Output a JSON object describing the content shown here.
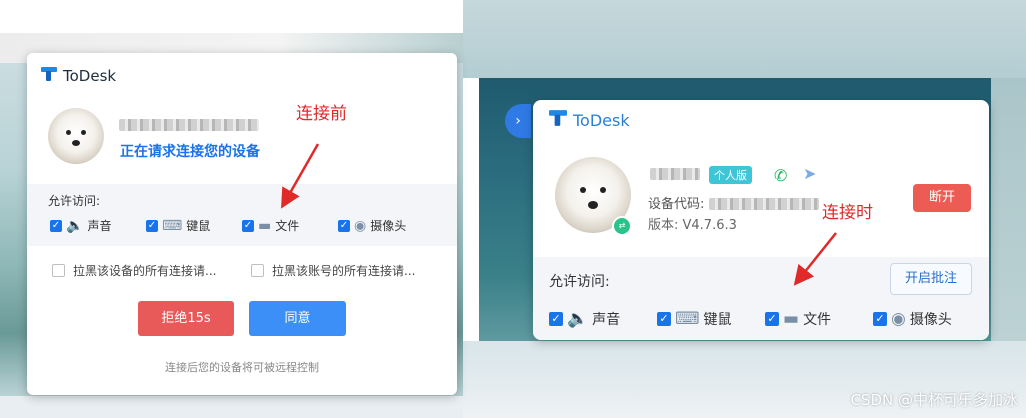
{
  "left_dialog": {
    "app_name": "ToDesk",
    "status": "正在请求连接您的设备",
    "permissions_title": "允许访问:",
    "permissions": [
      {
        "label": "声音",
        "icon": "speaker-icon",
        "checked": true
      },
      {
        "label": "键鼠",
        "icon": "keyboard-icon",
        "checked": true
      },
      {
        "label": "文件",
        "icon": "folder-icon",
        "checked": true
      },
      {
        "label": "摄像头",
        "icon": "camera-icon",
        "checked": true
      }
    ],
    "options": [
      {
        "label": "拉黑该设备的所有连接请...",
        "checked": false
      },
      {
        "label": "拉黑该账号的所有连接请...",
        "checked": false
      }
    ],
    "reject_button": "拒绝15s",
    "accept_button": "同意",
    "footnote": "连接后您的设备将可被远程控制"
  },
  "right_dialog": {
    "app_name": "ToDesk",
    "edition_badge": "个人版",
    "device_code_label": "设备代码:",
    "version": "版本: V4.7.6.3",
    "disconnect_button": "断开",
    "permissions_title": "允许访问:",
    "annotate_button": "开启批注",
    "permissions": [
      {
        "label": "声音",
        "icon": "speaker-icon",
        "checked": true
      },
      {
        "label": "键鼠",
        "icon": "keyboard-icon",
        "checked": true
      },
      {
        "label": "文件",
        "icon": "folder-icon",
        "checked": true
      },
      {
        "label": "摄像头",
        "icon": "camera-icon",
        "checked": true
      }
    ]
  },
  "annotations": {
    "before": "连接前",
    "during": "连接时"
  },
  "watermark": "CSDN @中杯可乐多加冰",
  "colors": {
    "accent": "#1a73e8",
    "reject": "#e85a5a",
    "accept": "#3b8ff7",
    "disconnect": "#ec5c55",
    "annotation": "#e02a2a"
  }
}
